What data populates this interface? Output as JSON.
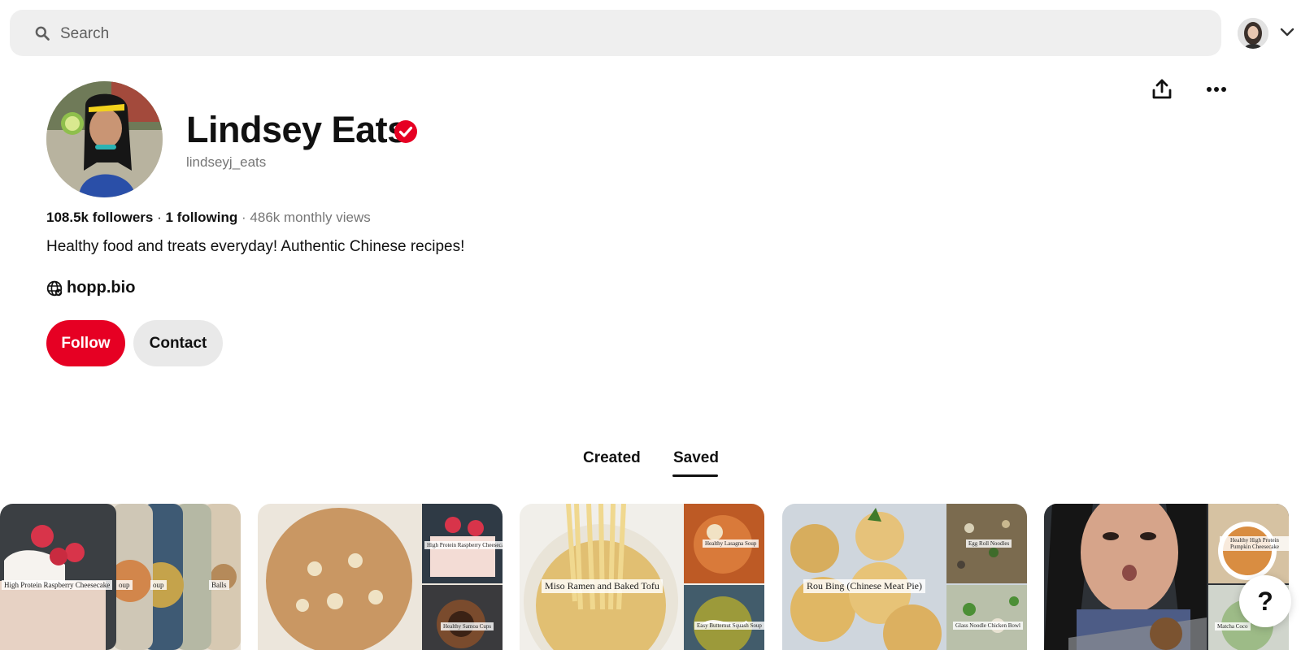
{
  "search": {
    "placeholder": "Search",
    "value": ""
  },
  "profile": {
    "name": "Lindsey Eats",
    "username": "lindseyj_eats",
    "followers": "108.5k followers",
    "following": "1 following",
    "monthly_views": "486k monthly views",
    "separator": "·",
    "bio": "Healthy food and treats everyday! Authentic Chinese recipes!",
    "website": "hopp.bio",
    "follow_label": "Follow",
    "contact_label": "Contact"
  },
  "tabs": [
    {
      "label": "Created",
      "active": false
    },
    {
      "label": "Saved",
      "active": true
    }
  ],
  "boards": [
    {
      "captions": [
        "High Protein Raspberry Cheesecake",
        "oup",
        "oup",
        "Balls"
      ]
    },
    {
      "captions": [
        "High Protein Raspberry Cheesecake",
        "Healthy Samoa Cups"
      ]
    },
    {
      "captions": [
        "Miso Ramen and Baked Tofu",
        "Healthy Lasagna Soup",
        "Easy Butternut Squash Soup"
      ]
    },
    {
      "captions": [
        "Rou Bing (Chinese Meat Pie)",
        "Egg Roll Noodles",
        "Glass Noodle Chicken Bowl"
      ]
    },
    {
      "captions": [
        "Healthy High Protein Pumpkin Cheesecake",
        "Matcha Coco"
      ]
    }
  ],
  "help_label": "?",
  "colors": {
    "accent": "#e60023",
    "verified": "#e60023",
    "muted_text": "#767676",
    "search_bg": "#efefef"
  },
  "icons": [
    "search-icon",
    "chevron-down-icon",
    "verified-badge-icon",
    "share-icon",
    "more-icon",
    "globe-icon",
    "help-icon"
  ]
}
